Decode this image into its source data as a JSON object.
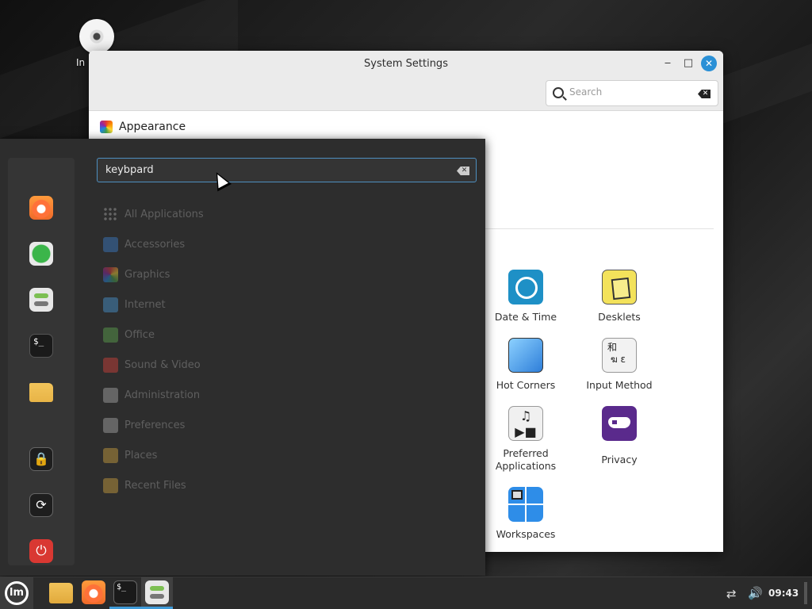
{
  "desktop": {
    "icon_label": "In"
  },
  "settings_window": {
    "title": "System Settings",
    "controls": {
      "minimize": "‒",
      "maximize": "□",
      "close": "✕"
    },
    "search": {
      "value": "",
      "placeholder": "Search",
      "clear": "✕"
    },
    "section_title": "Appearance",
    "tiles": [
      {
        "label": "Date & Time",
        "icon": "clock-icon"
      },
      {
        "label": "Desklets",
        "icon": "desklets-icon"
      },
      {
        "label": "Hot Corners",
        "icon": "hot-corners-icon"
      },
      {
        "label": "Input Method",
        "icon": "input-method-icon",
        "glyph": "和\n ฆ ɛ"
      },
      {
        "label": "Preferred Applications",
        "icon": "preferred-apps-icon",
        "glyph": "♫\n▶■"
      },
      {
        "label": "Privacy",
        "icon": "privacy-mask-icon"
      },
      {
        "label": "Workspaces",
        "icon": "workspaces-icon"
      }
    ]
  },
  "menu": {
    "search": {
      "value": "keybpard",
      "clear": "✕"
    },
    "favorites": [
      {
        "name": "firefox-icon"
      },
      {
        "name": "software-manager-icon"
      },
      {
        "name": "system-settings-icon"
      },
      {
        "name": "terminal-icon",
        "glyph": "$_"
      },
      {
        "name": "files-folder-icon"
      }
    ],
    "session": [
      {
        "name": "lock-screen-icon",
        "glyph": "🔒"
      },
      {
        "name": "logout-icon",
        "glyph": "⟳"
      },
      {
        "name": "power-icon",
        "glyph": "⏻"
      }
    ],
    "categories": [
      "All Applications",
      "Accessories",
      "Graphics",
      "Internet",
      "Office",
      "Sound & Video",
      "Administration",
      "Preferences",
      "Places",
      "Recent Files"
    ]
  },
  "taskbar": {
    "mint_logo": "lm",
    "terminal_glyph": "$_",
    "network_glyph": "⇄",
    "volume_glyph": "🔊",
    "clock": "09:43"
  },
  "colors": {
    "accent": "#2a90d6",
    "menu_bg": "#2d2d2d",
    "taskbar_bg": "#2b2b2b"
  }
}
